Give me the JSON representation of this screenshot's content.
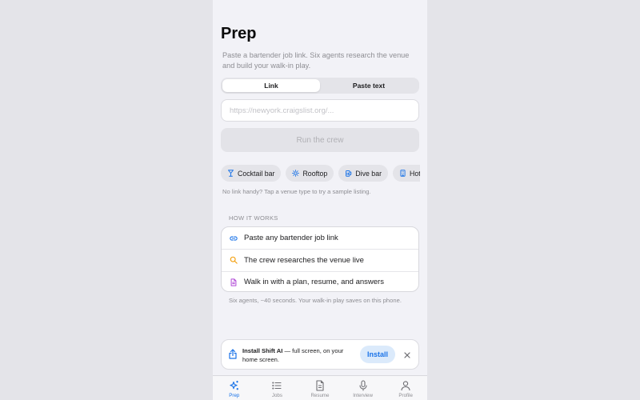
{
  "page": {
    "title": "Prep",
    "subtitle": "Paste a bartender job link. Six agents research the venue and build your walk-in play."
  },
  "mode_toggle": {
    "options": [
      "Link",
      "Paste text"
    ],
    "selected": "Link"
  },
  "link_input": {
    "value": "",
    "placeholder": "https://newyork.craigslist.org/..."
  },
  "run_button": {
    "label": "Run the crew",
    "state": "disabled"
  },
  "venue_chips": [
    {
      "label": "Cocktail bar",
      "icon": "cocktail-glass-icon"
    },
    {
      "label": "Rooftop",
      "icon": "sun-icon"
    },
    {
      "label": "Dive bar",
      "icon": "beer-mug-icon"
    },
    {
      "label": "Hotel bar",
      "icon": "building-icon"
    }
  ],
  "hint": "No link handy? Tap a venue type to try a sample listing.",
  "how_it_works": {
    "label": "HOW IT WORKS",
    "steps": [
      {
        "text": "Paste any bartender job link",
        "icon": "link-icon",
        "color": "#1a73e8"
      },
      {
        "text": "The crew researches the venue live",
        "icon": "search-icon",
        "color": "#f29a00"
      },
      {
        "text": "Walk in with a plan, resume, and answers",
        "icon": "document-icon",
        "color": "#b14ad6"
      }
    ],
    "footnote": "Six agents, ~40 seconds. Your walk-in play saves on this phone."
  },
  "install_banner": {
    "title": "Install Shift AI",
    "text": " — full screen, on your home screen.",
    "button": "Install"
  },
  "tabbar": {
    "items": [
      {
        "label": "Prep",
        "icon": "sparkles-icon",
        "active": true
      },
      {
        "label": "Jobs",
        "icon": "list-icon",
        "active": false
      },
      {
        "label": "Resume",
        "icon": "document-icon",
        "active": false
      },
      {
        "label": "Interview",
        "icon": "microphone-icon",
        "active": false
      },
      {
        "label": "Profile",
        "icon": "person-icon",
        "active": false
      }
    ]
  },
  "colors": {
    "accent": "#1a73e8",
    "background": "#f2f2f7",
    "outer_background": "#e4e4e9"
  }
}
